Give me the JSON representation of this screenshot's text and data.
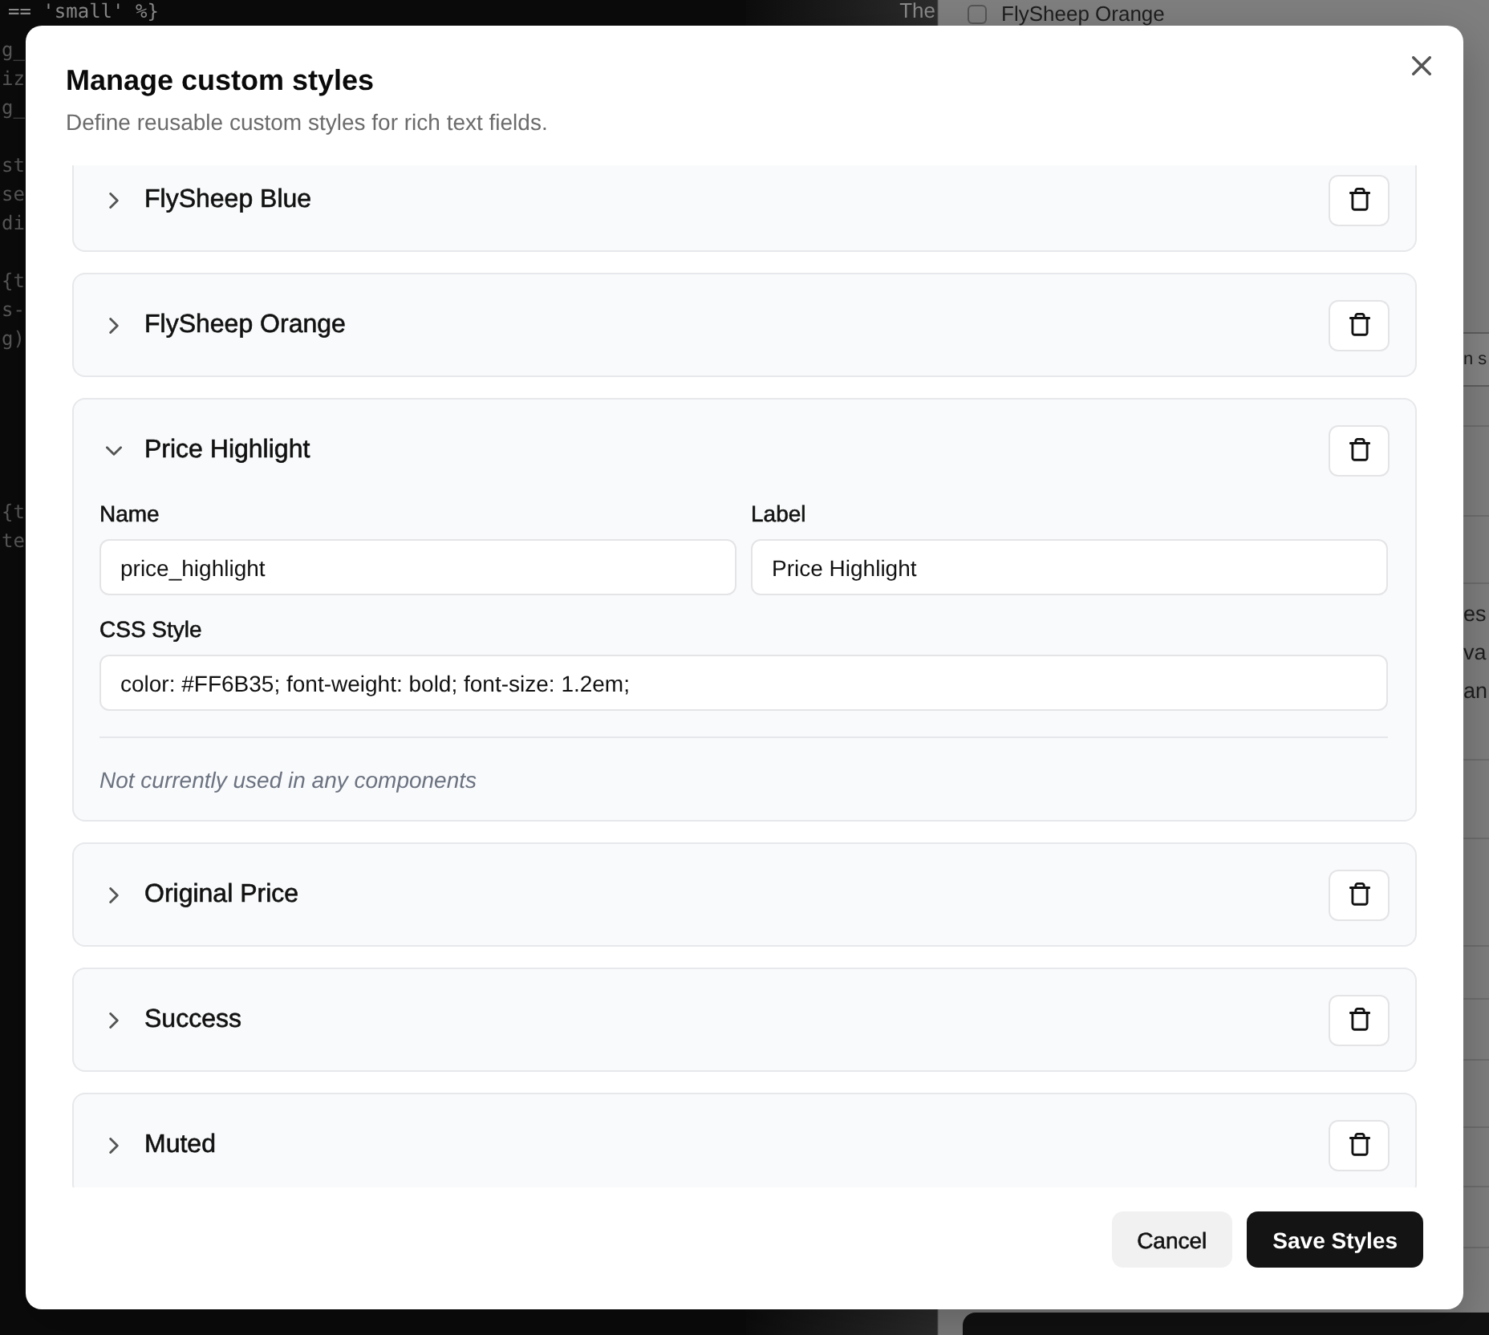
{
  "backdrop": {
    "code_editor": {
      "blocks": [
        [
          "== 'small' %}",
          "g_",
          "iz",
          "g_"
        ],
        [
          "st",
          "se",
          "di"
        ],
        [
          "{t",
          "s-",
          "g)"
        ],
        [
          "{t",
          "te"
        ]
      ]
    },
    "preview": {
      "heading_fragment": "The",
      "option": {
        "label": "FlySheep Orange",
        "checked": false
      },
      "button_fragment": "n s",
      "text_fragments": [
        "es",
        "va",
        "an"
      ]
    }
  },
  "dialog": {
    "title": "Manage custom styles",
    "description": "Define reusable custom styles for rich text fields.",
    "styles": [
      {
        "label": "FlySheep Blue",
        "expanded": false
      },
      {
        "label": "FlySheep Orange",
        "expanded": false
      },
      {
        "label": "Price Highlight",
        "expanded": true,
        "fields": [
          {
            "label": "Name",
            "value": "price_highlight"
          },
          {
            "label": "Label",
            "value": "Price Highlight"
          },
          {
            "label": "CSS Style",
            "value": "color: #FF6B35; font-weight: bold; font-size: 1.2em;"
          }
        ],
        "usage_note": "Not currently used in any components"
      },
      {
        "label": "Original Price",
        "expanded": false
      },
      {
        "label": "Success",
        "expanded": false
      },
      {
        "label": "Muted",
        "expanded": false
      }
    ],
    "buttons": [
      {
        "label": "Cancel",
        "kind": "secondary"
      },
      {
        "label": "Save Styles",
        "kind": "primary"
      }
    ]
  }
}
